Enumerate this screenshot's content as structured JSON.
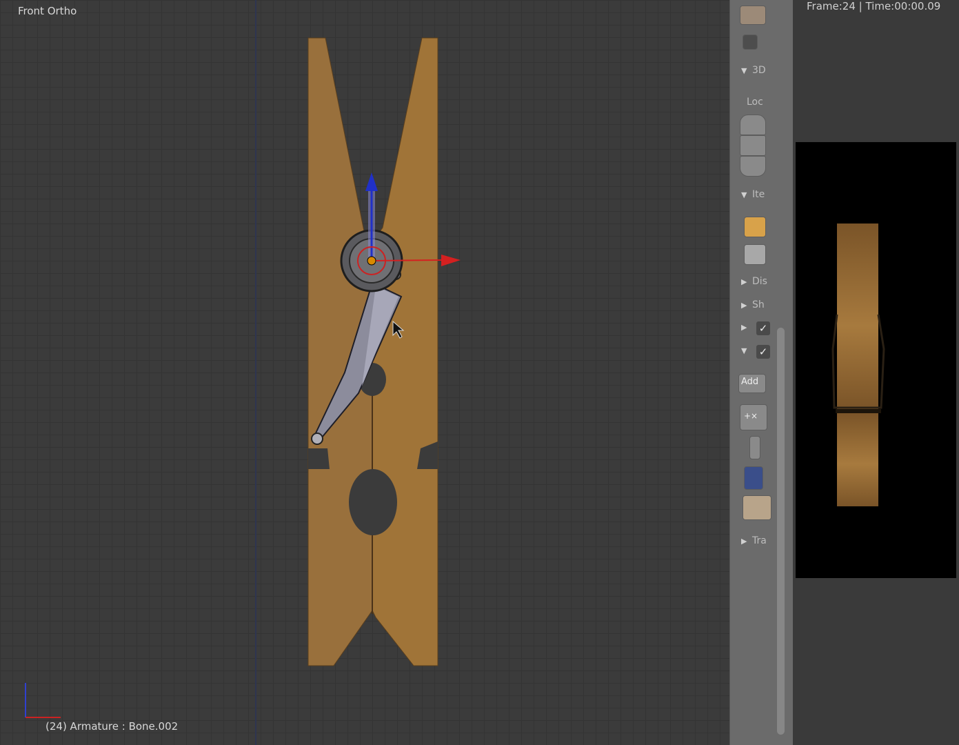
{
  "viewport": {
    "view_name": "Front Ortho",
    "status_text": "(24) Armature : Bone.002"
  },
  "sidebar": {
    "labels": {
      "panel_3d": "3D",
      "loc": "Loc",
      "panel_ite": "Ite",
      "panel_dis": "Dis",
      "panel_sh": "Sh",
      "add": "Add",
      "x_toggle": "+×",
      "panel_tra": "Tra"
    }
  },
  "preview": {
    "frame_info": "Frame:24 | Time:00:00.09"
  },
  "colors": {
    "wood": "#99703c",
    "viewport_bg": "#3b3b3b",
    "bone": "#8c8c9c",
    "x_axis": "#d42020",
    "z_axis": "#2030c8"
  },
  "icons": [
    "camera-icon",
    "render-icon",
    "checkbox-icon",
    "pencil-icon",
    "lock-icon",
    "folder-icon",
    "grip-icon"
  ]
}
